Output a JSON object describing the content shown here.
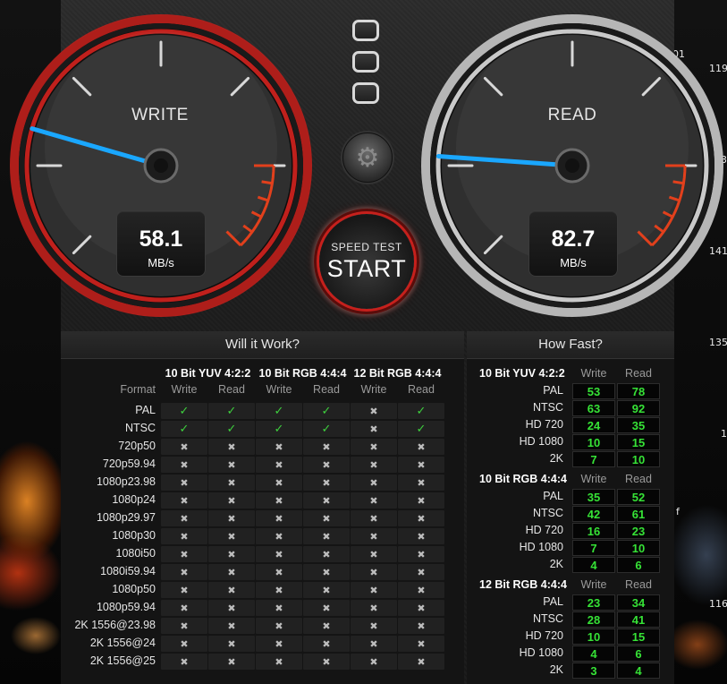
{
  "background": {
    "side_numbers": [
      "01",
      "119",
      "3",
      "141",
      "135",
      "1",
      "f",
      "116"
    ]
  },
  "gauges": {
    "write": {
      "label": "WRITE",
      "value": "58.1",
      "unit": "MB/s",
      "ring_color": "#c0201c"
    },
    "read": {
      "label": "READ",
      "value": "82.7",
      "unit": "MB/s",
      "ring_color": "#c9c9c9"
    },
    "needle_color": "#1aa7ff",
    "redline_color": "#e2401c"
  },
  "controls": {
    "settings_icon": "gear-icon",
    "start_top_label": "SPEED TEST",
    "start_label": "START"
  },
  "will_it_work": {
    "title": "Will it Work?",
    "format_header": "Format",
    "groups": [
      "10 Bit YUV 4:2:2",
      "10 Bit RGB 4:4:4",
      "12 Bit RGB 4:4:4"
    ],
    "sub_headers": [
      "Write",
      "Read"
    ],
    "rows": [
      {
        "format": "PAL",
        "cells": [
          1,
          1,
          1,
          1,
          0,
          1
        ]
      },
      {
        "format": "NTSC",
        "cells": [
          1,
          1,
          1,
          1,
          0,
          1
        ]
      },
      {
        "format": "720p50",
        "cells": [
          0,
          0,
          0,
          0,
          0,
          0
        ]
      },
      {
        "format": "720p59.94",
        "cells": [
          0,
          0,
          0,
          0,
          0,
          0
        ]
      },
      {
        "format": "1080p23.98",
        "cells": [
          0,
          0,
          0,
          0,
          0,
          0
        ]
      },
      {
        "format": "1080p24",
        "cells": [
          0,
          0,
          0,
          0,
          0,
          0
        ]
      },
      {
        "format": "1080p29.97",
        "cells": [
          0,
          0,
          0,
          0,
          0,
          0
        ]
      },
      {
        "format": "1080p30",
        "cells": [
          0,
          0,
          0,
          0,
          0,
          0
        ]
      },
      {
        "format": "1080i50",
        "cells": [
          0,
          0,
          0,
          0,
          0,
          0
        ]
      },
      {
        "format": "1080i59.94",
        "cells": [
          0,
          0,
          0,
          0,
          0,
          0
        ]
      },
      {
        "format": "1080p50",
        "cells": [
          0,
          0,
          0,
          0,
          0,
          0
        ]
      },
      {
        "format": "1080p59.94",
        "cells": [
          0,
          0,
          0,
          0,
          0,
          0
        ]
      },
      {
        "format": "2K 1556@23.98",
        "cells": [
          0,
          0,
          0,
          0,
          0,
          0
        ]
      },
      {
        "format": "2K 1556@24",
        "cells": [
          0,
          0,
          0,
          0,
          0,
          0
        ]
      },
      {
        "format": "2K 1556@25",
        "cells": [
          0,
          0,
          0,
          0,
          0,
          0
        ]
      }
    ],
    "yes_symbol": "✓",
    "no_symbol": "✖"
  },
  "how_fast": {
    "title": "How Fast?",
    "sub_headers": [
      "Write",
      "Read"
    ],
    "groups": [
      {
        "name": "10 Bit YUV 4:2:2",
        "rows": [
          {
            "format": "PAL",
            "write": "53",
            "read": "78"
          },
          {
            "format": "NTSC",
            "write": "63",
            "read": "92"
          },
          {
            "format": "HD 720",
            "write": "24",
            "read": "35"
          },
          {
            "format": "HD 1080",
            "write": "10",
            "read": "15"
          },
          {
            "format": "2K",
            "write": "7",
            "read": "10"
          }
        ]
      },
      {
        "name": "10 Bit RGB 4:4:4",
        "rows": [
          {
            "format": "PAL",
            "write": "35",
            "read": "52"
          },
          {
            "format": "NTSC",
            "write": "42",
            "read": "61"
          },
          {
            "format": "HD 720",
            "write": "16",
            "read": "23"
          },
          {
            "format": "HD 1080",
            "write": "7",
            "read": "10"
          },
          {
            "format": "2K",
            "write": "4",
            "read": "6"
          }
        ]
      },
      {
        "name": "12 Bit RGB 4:4:4",
        "rows": [
          {
            "format": "PAL",
            "write": "23",
            "read": "34"
          },
          {
            "format": "NTSC",
            "write": "28",
            "read": "41"
          },
          {
            "format": "HD 720",
            "write": "10",
            "read": "15"
          },
          {
            "format": "HD 1080",
            "write": "4",
            "read": "6"
          },
          {
            "format": "2K",
            "write": "3",
            "read": "4"
          }
        ]
      }
    ]
  }
}
